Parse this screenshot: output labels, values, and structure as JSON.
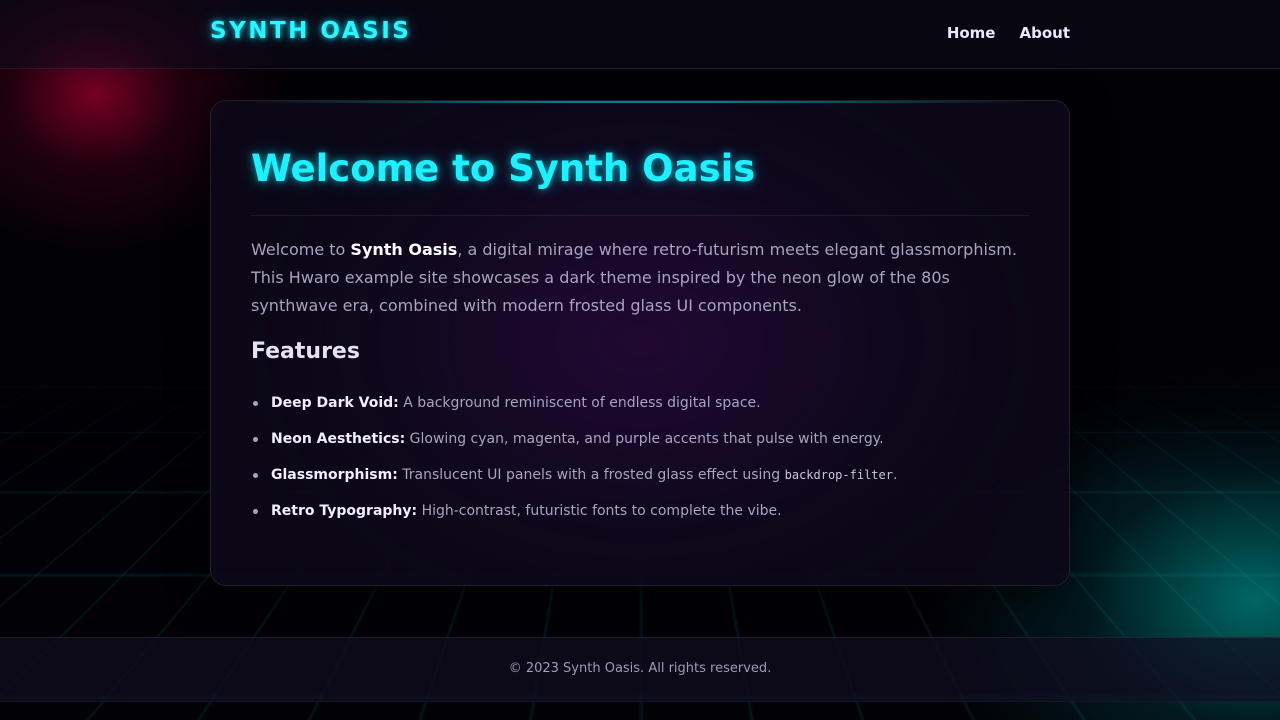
{
  "header": {
    "logo": "SYNTH OASIS",
    "nav": [
      {
        "label": "Home"
      },
      {
        "label": "About"
      }
    ]
  },
  "main": {
    "title": "Welcome to Synth Oasis",
    "intro": {
      "before": "Welcome to ",
      "brand": "Synth Oasis",
      "after": ", a digital mirage where retro-futurism meets elegant glassmorphism. This Hwaro example site showcases a dark theme inspired by the neon glow of the 80s synthwave era, combined with modern frosted glass UI components."
    },
    "features_heading": "Features",
    "features": [
      {
        "term": "Deep Dark Void:",
        "desc": "A background reminiscent of endless digital space.",
        "code": "",
        "suffix": ""
      },
      {
        "term": "Neon Aesthetics:",
        "desc": "Glowing cyan, magenta, and purple accents that pulse with energy.",
        "code": "",
        "suffix": ""
      },
      {
        "term": "Glassmorphism:",
        "desc": "Translucent UI panels with a frosted glass effect using ",
        "code": "backdrop-filter",
        "suffix": "."
      },
      {
        "term": "Retro Typography:",
        "desc": "High-contrast, futuristic fonts to complete the vibe.",
        "code": "",
        "suffix": ""
      }
    ]
  },
  "footer": {
    "text": "© 2023 Synth Oasis. All rights reserved."
  },
  "colors": {
    "accent_cyan": "#1ff0ff",
    "background": "#020106",
    "glow_magenta": "#96002d",
    "glow_teal": "#00aaa5"
  }
}
